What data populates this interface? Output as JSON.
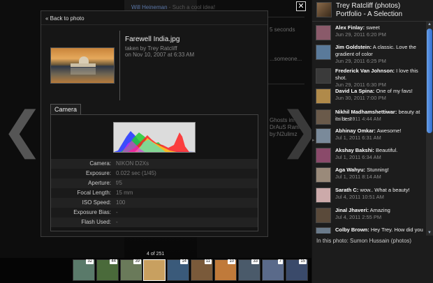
{
  "background": {
    "comment_author": "Will Heineman",
    "comment_text": "Such a cool idea!",
    "side_snippets": [
      "5 seconds",
      "...someone...",
      "Ghosts in!",
      "DrAuS Rams",
      "by:N2ulimz"
    ]
  },
  "panel": {
    "back_label": "« Back to photo",
    "photo_title": "Farewell India.jpg",
    "taken_by": "taken by Trey Ratcliff",
    "taken_on": "on Nov 10, 2007 at 6:33 AM",
    "tab_label": "Camera",
    "exif": [
      {
        "key": "Camera:",
        "value": "NIKON D2Xs"
      },
      {
        "key": "Exposure:",
        "value": "0.022 sec (1/45)"
      },
      {
        "key": "Aperture:",
        "value": "f/5"
      },
      {
        "key": "Focal Length:",
        "value": "15 mm"
      },
      {
        "key": "ISO Speed:",
        "value": "100"
      },
      {
        "key": "Exposure Bias:",
        "value": "-"
      },
      {
        "key": "Flash Used:",
        "value": "-"
      }
    ]
  },
  "navigation": {
    "prev_icon": "chevron-left-icon",
    "next_icon": "chevron-right-icon",
    "close_glyph": "✕"
  },
  "filmstrip": {
    "counter": "4 of 251",
    "frames": [
      {
        "badge": "32",
        "color": "#5a7a6a"
      },
      {
        "badge": "44",
        "color": "#4a6a3a"
      },
      {
        "badge": "39",
        "color": "#6a7a5a"
      },
      {
        "badge": "",
        "color": "#c8a060"
      },
      {
        "badge": "14",
        "color": "#3a5a7a"
      },
      {
        "badge": "11",
        "color": "#7a5a3a"
      },
      {
        "badge": "10",
        "color": "#c07a3a"
      },
      {
        "badge": "33",
        "color": "#4a5a6a"
      },
      {
        "badge": "7",
        "color": "#5a6a8a"
      },
      {
        "badge": "15",
        "color": "#3a4a6a"
      }
    ]
  },
  "sidebar": {
    "owner": "Trey Ratcliff (photos)",
    "set": "Portfolio - A Selection",
    "comments": [
      {
        "author": "Alex Finlay:",
        "text": "sweet",
        "date": "Jun 29, 2011 6:20 PM",
        "color": "#8a5a6a"
      },
      {
        "author": "Jim Goldstein:",
        "text": "A classic. Love the gradient of color",
        "date": "Jun 29, 2011 6:25 PM",
        "color": "#5a7a9a"
      },
      {
        "author": "Frederick Van Johnson:",
        "text": "I love this shot.",
        "date": "Jun 29, 2011 6:30 PM",
        "color": "#3a3a3a"
      },
      {
        "author": "David La Spina:",
        "text": "One of my favs!",
        "date": "Jun 30, 2011 7:00 PM",
        "color": "#b08a4a"
      },
      {
        "author": "Nikhil Madhamshettiwar:",
        "text": "beauty at its best !",
        "date": "Jul 1, 2011 4:44 AM",
        "color": "#6a5a4a"
      },
      {
        "author": "Abhinay Omkar:",
        "text": "Awesome!",
        "date": "Jul 1, 2011 6:31 AM",
        "color": "#7a8a9a"
      },
      {
        "author": "Akshay Bakshi:",
        "text": "Beautiful.",
        "date": "Jul 1, 2011 6:34 AM",
        "color": "#8a4a6a"
      },
      {
        "author": "Aga Wahyu:",
        "text": "Stunning!",
        "date": "Jul 1, 2011 8:14 AM",
        "color": "#9a8a7a"
      },
      {
        "author": "Sarath C:",
        "text": "wow.. What a beauty!",
        "date": "Jul 4, 2011 10:51 AM",
        "color": "#caa"
      },
      {
        "author": "Jinal Jhaveri:",
        "text": "Amazing",
        "date": "Jul 4, 2011 2:55 PM",
        "color": "#5a4a3a"
      },
      {
        "author": "Colby Brown:",
        "text": "Hey Trey. How did you",
        "date": "",
        "color": "#6a7a8a"
      }
    ],
    "in_this_photo": "In this photo: Sumon Hussain (photos)"
  }
}
